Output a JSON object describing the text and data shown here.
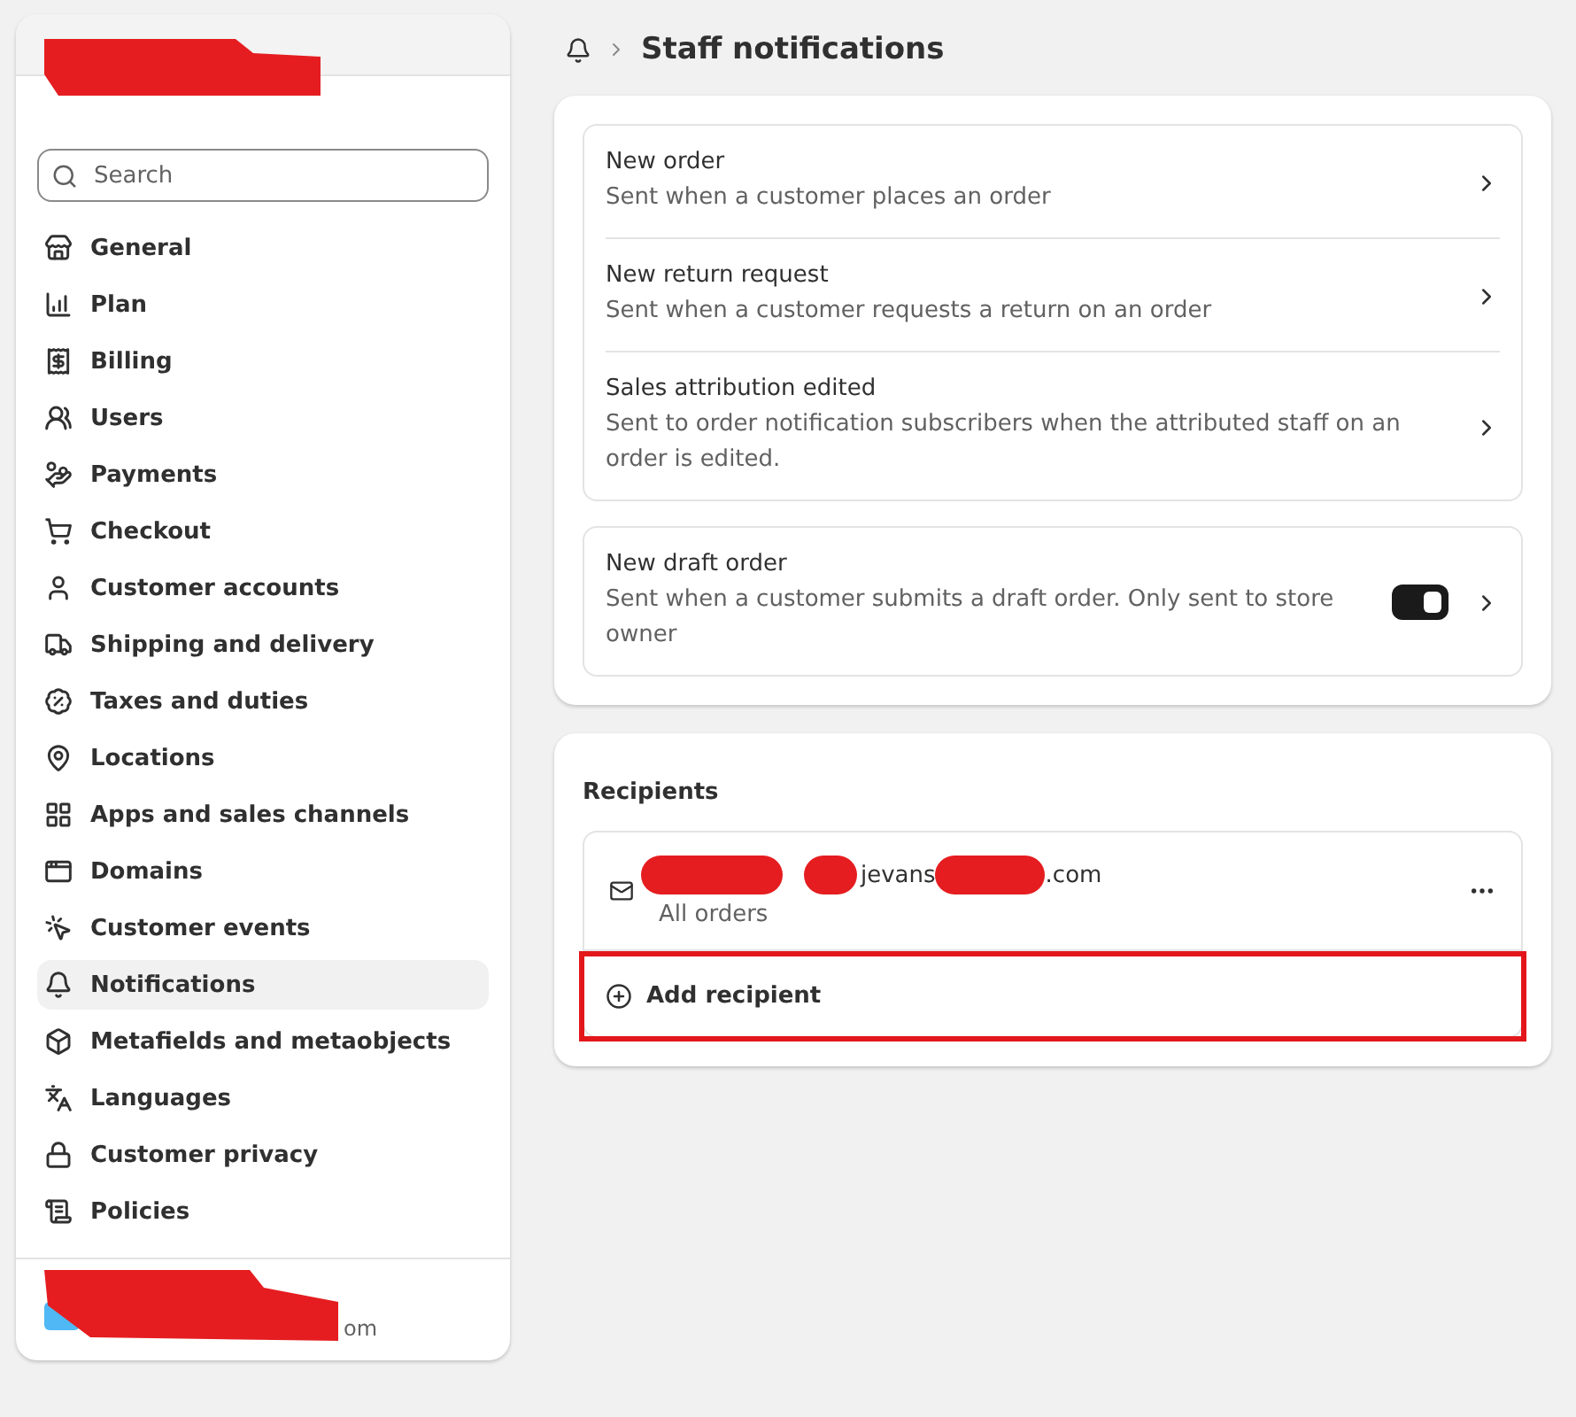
{
  "sidebar": {
    "search": {
      "placeholder": "Search"
    },
    "items": [
      {
        "label": "General",
        "selected": false
      },
      {
        "label": "Plan",
        "selected": false
      },
      {
        "label": "Billing",
        "selected": false
      },
      {
        "label": "Users",
        "selected": false
      },
      {
        "label": "Payments",
        "selected": false
      },
      {
        "label": "Checkout",
        "selected": false
      },
      {
        "label": "Customer accounts",
        "selected": false
      },
      {
        "label": "Shipping and delivery",
        "selected": false
      },
      {
        "label": "Taxes and duties",
        "selected": false
      },
      {
        "label": "Locations",
        "selected": false
      },
      {
        "label": "Apps and sales channels",
        "selected": false
      },
      {
        "label": "Domains",
        "selected": false
      },
      {
        "label": "Customer events",
        "selected": false
      },
      {
        "label": "Notifications",
        "selected": true
      },
      {
        "label": "Metafields and metaobjects",
        "selected": false
      },
      {
        "label": "Languages",
        "selected": false
      },
      {
        "label": "Customer privacy",
        "selected": false
      },
      {
        "label": "Policies",
        "selected": false
      }
    ],
    "footer": {
      "email_tail": "om"
    }
  },
  "header": {
    "title": "Staff notifications"
  },
  "notification_groups": [
    [
      {
        "kind": "link",
        "title": "New order",
        "description": "Sent when a customer places an order"
      },
      {
        "kind": "link",
        "title": "New return request",
        "description": "Sent when a customer requests a return on an order"
      },
      {
        "kind": "link",
        "title": "Sales attribution edited",
        "description": "Sent to order notification subscribers when the attributed staff on an order is edited."
      }
    ],
    [
      {
        "kind": "toggle",
        "on": true,
        "title": "New draft order",
        "description": "Sent when a customer submits a draft order. Only sent to store owner"
      }
    ]
  ],
  "recipients": {
    "title": "Recipients",
    "items": [
      {
        "email_parts": [
          "jevans",
          ".com"
        ],
        "subtitle": "All orders"
      }
    ],
    "add_label": "Add recipient",
    "add_highlighted": true
  }
}
